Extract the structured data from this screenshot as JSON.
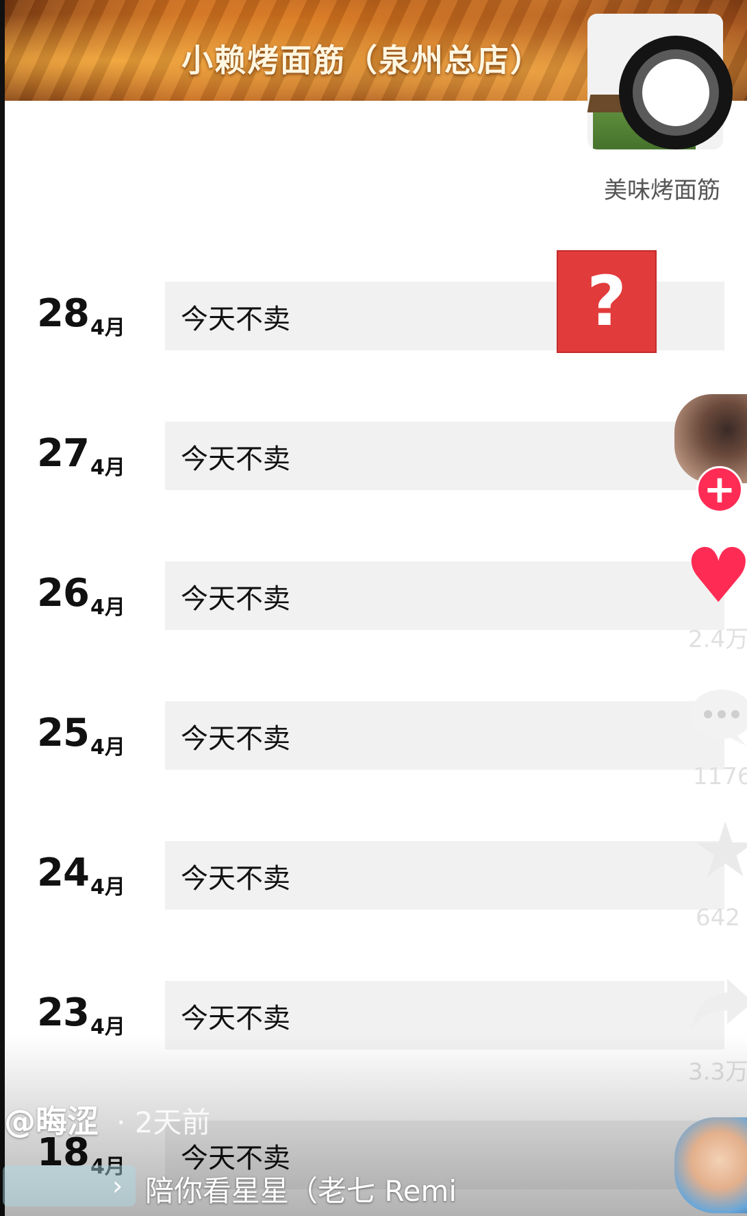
{
  "header": {
    "shop_title": "小赖烤面筋（泉州总店）",
    "shop_subtitle": "美味烤面筋"
  },
  "rows": [
    {
      "day": "28",
      "month": "4月",
      "status": "今天不卖"
    },
    {
      "day": "27",
      "month": "4月",
      "status": "今天不卖"
    },
    {
      "day": "26",
      "month": "4月",
      "status": "今天不卖"
    },
    {
      "day": "25",
      "month": "4月",
      "status": "今天不卖"
    },
    {
      "day": "24",
      "month": "4月",
      "status": "今天不卖"
    },
    {
      "day": "23",
      "month": "4月",
      "status": "今天不卖"
    },
    {
      "day": "18",
      "month": "4月",
      "status": "今天不卖"
    }
  ],
  "question_mark": "?",
  "rail": {
    "follow_symbol": "+",
    "likes": "2.4万",
    "comments": "1176",
    "favorites": "642",
    "shares": "3.3万"
  },
  "video": {
    "author": "@晦涩",
    "time_ago": "· 2天前",
    "music": "陪你看星星（老七 Remi",
    "music_chevron": "›"
  },
  "icons": [
    "camera-shutter-icon",
    "heart-icon",
    "comment-icon",
    "star-icon",
    "share-icon",
    "plus-icon",
    "chevron-right-icon"
  ],
  "colors": {
    "accent_red": "#fe2c55",
    "question_red": "#e23b3b",
    "row_bg": "#f1f1f1"
  }
}
